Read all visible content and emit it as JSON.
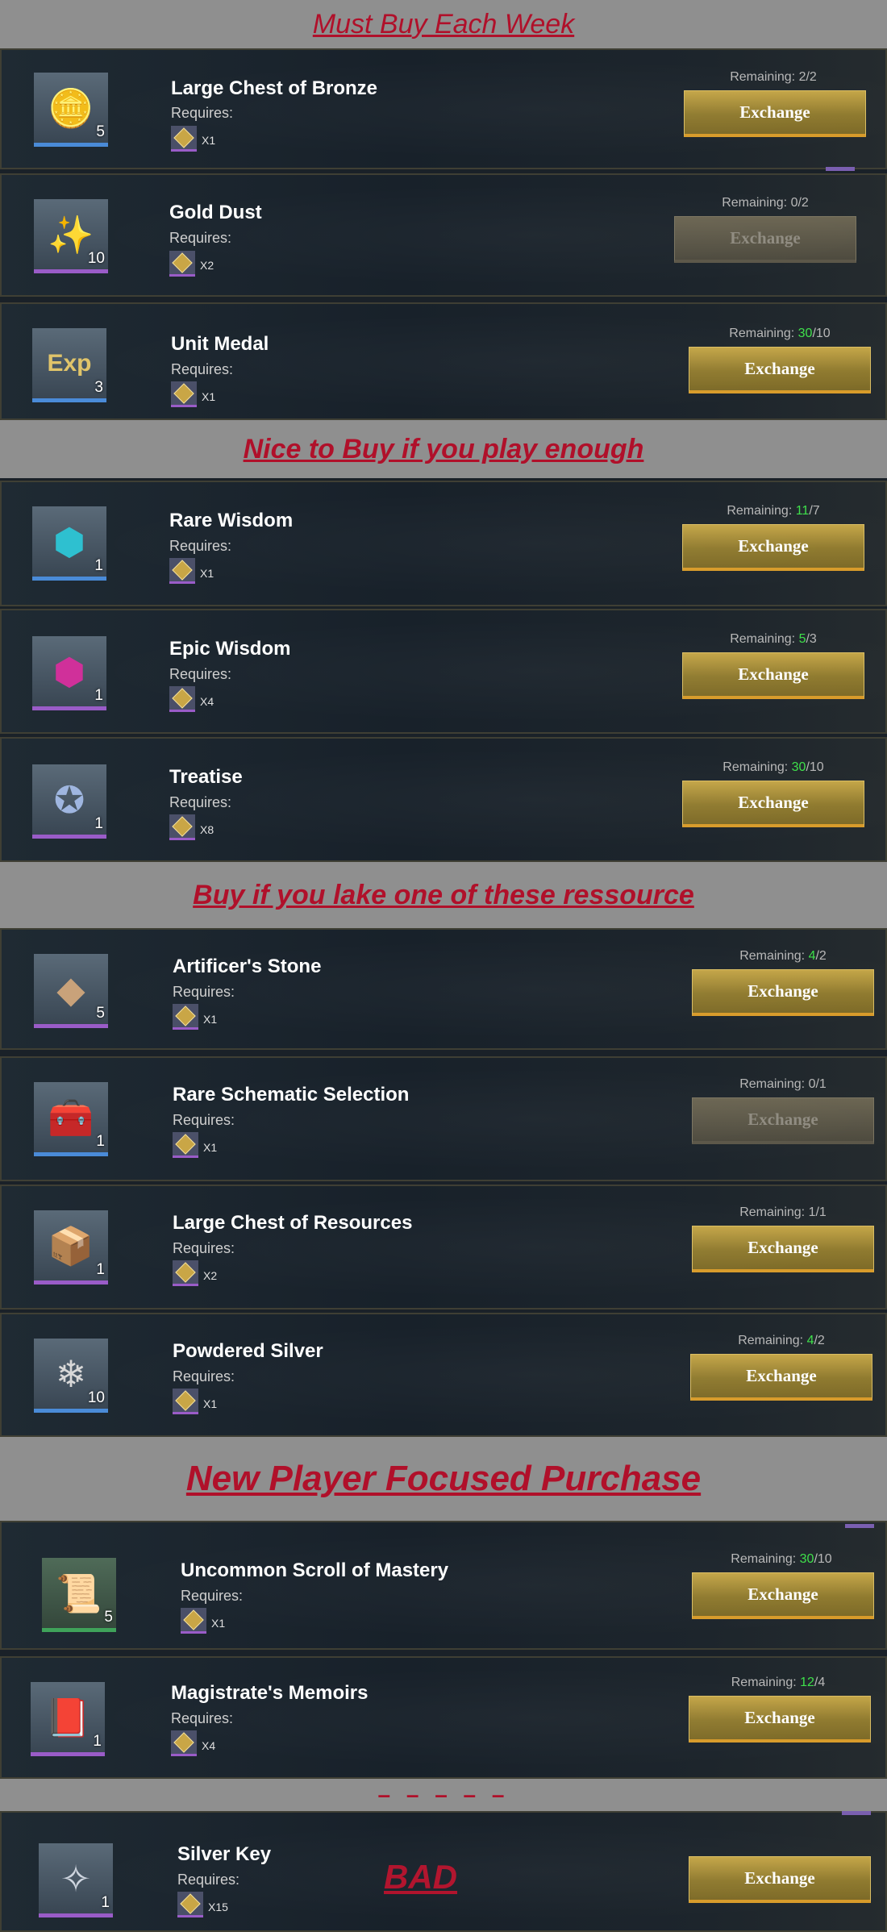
{
  "sections": [
    {
      "title": "Must Buy Each Week"
    },
    {
      "title": "Nice to Buy if you play enough"
    },
    {
      "title": "Buy if you lake one of these ressource"
    },
    {
      "title": "New Player Focused Purchase"
    },
    {
      "title": "– – – – –"
    }
  ],
  "common": {
    "requires_label": "Requires:",
    "remaining_prefix": "Remaining: ",
    "exchange_label": "Exchange"
  },
  "items": [
    {
      "name": "Large Chest of Bronze",
      "count": "5",
      "cost": "X1",
      "remaining_current": "2",
      "remaining_total": "/2",
      "highlight": false,
      "enabled": true,
      "icon": "chest-icon",
      "rarity": "blue"
    },
    {
      "name": "Gold Dust",
      "count": "10",
      "cost": "X2",
      "remaining_current": "0",
      "remaining_total": "/2",
      "highlight": false,
      "enabled": false,
      "icon": "gold-dust-icon",
      "rarity": "purple"
    },
    {
      "name": "Unit Medal",
      "count": "3",
      "cost": "X1",
      "remaining_current": "30",
      "remaining_total": "/10",
      "highlight": true,
      "enabled": true,
      "icon": "exp-medal-icon",
      "rarity": "blue"
    },
    {
      "name": "Rare Wisdom",
      "count": "1",
      "cost": "X1",
      "remaining_current": "11",
      "remaining_total": "/7",
      "highlight": true,
      "enabled": true,
      "icon": "blue-gem-icon",
      "rarity": "blue"
    },
    {
      "name": "Epic Wisdom",
      "count": "1",
      "cost": "X4",
      "remaining_current": "5",
      "remaining_total": "/3",
      "highlight": true,
      "enabled": true,
      "icon": "purple-gem-icon",
      "rarity": "purple"
    },
    {
      "name": "Treatise",
      "count": "1",
      "cost": "X8",
      "remaining_current": "30",
      "remaining_total": "/10",
      "highlight": true,
      "enabled": true,
      "icon": "treatise-icon",
      "rarity": "purple"
    },
    {
      "name": "Artificer's Stone",
      "count": "5",
      "cost": "X1",
      "remaining_current": "4",
      "remaining_total": "/2",
      "highlight": true,
      "enabled": true,
      "icon": "stone-icon",
      "rarity": "purple"
    },
    {
      "name": "Rare Schematic Selection",
      "count": "1",
      "cost": "X1",
      "remaining_current": "0",
      "remaining_total": "/1",
      "highlight": false,
      "enabled": false,
      "icon": "schematic-chest-icon",
      "rarity": "blue"
    },
    {
      "name": "Large Chest of Resources",
      "count": "1",
      "cost": "X2",
      "remaining_current": "1",
      "remaining_total": "/1",
      "highlight": false,
      "enabled": true,
      "icon": "resources-chest-icon",
      "rarity": "purple"
    },
    {
      "name": "Powdered Silver",
      "count": "10",
      "cost": "X1",
      "remaining_current": "4",
      "remaining_total": "/2",
      "highlight": true,
      "enabled": true,
      "icon": "silver-powder-icon",
      "rarity": "blue"
    },
    {
      "name": "Uncommon Scroll of Mastery",
      "count": "5",
      "cost": "X1",
      "remaining_current": "30",
      "remaining_total": "/10",
      "highlight": true,
      "enabled": true,
      "icon": "scroll-icon",
      "rarity": "green"
    },
    {
      "name": "Magistrate's Memoirs",
      "count": "1",
      "cost": "X4",
      "remaining_current": "12",
      "remaining_total": "/4",
      "highlight": true,
      "enabled": true,
      "icon": "book-icon",
      "rarity": "purple"
    },
    {
      "name": "Silver Key",
      "count": "1",
      "cost": "X15",
      "remaining_current": "",
      "remaining_total": "",
      "highlight": false,
      "enabled": true,
      "icon": "silver-key-icon",
      "rarity": "purple"
    }
  ],
  "bad_label": "BAD"
}
